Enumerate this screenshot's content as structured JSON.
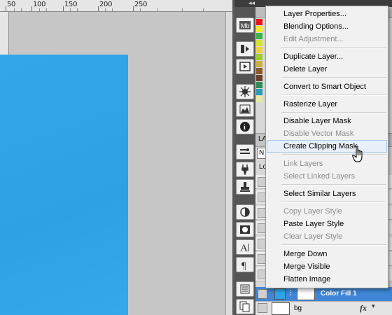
{
  "ruler": {
    "labels": [
      "50",
      "100",
      "150",
      "200",
      "250"
    ]
  },
  "layers_panel": {
    "tab_label": "LA",
    "blend_mode": "N",
    "lock_label": "Lo",
    "layers": [
      {
        "name": "Color Fill 1",
        "selected": true
      },
      {
        "name": "bg",
        "selected": false,
        "fx": "fx"
      }
    ]
  },
  "context_menu": {
    "items": [
      {
        "label": "Layer Properties...",
        "enabled": true
      },
      {
        "label": "Blending Options...",
        "enabled": true
      },
      {
        "label": "Edit Adjustment...",
        "enabled": false
      },
      {
        "label": "Duplicate Layer...",
        "enabled": true
      },
      {
        "label": "Delete Layer",
        "enabled": true
      },
      {
        "label": "Convert to Smart Object",
        "enabled": true
      },
      {
        "label": "Rasterize Layer",
        "enabled": true
      },
      {
        "label": "Disable Layer Mask",
        "enabled": true
      },
      {
        "label": "Disable Vector Mask",
        "enabled": false
      },
      {
        "label": "Create Clipping Mask",
        "enabled": true,
        "hovered": true
      },
      {
        "label": "Link Layers",
        "enabled": false
      },
      {
        "label": "Select Linked Layers",
        "enabled": false
      },
      {
        "label": "Select Similar Layers",
        "enabled": true
      },
      {
        "label": "Copy Layer Style",
        "enabled": false
      },
      {
        "label": "Paste Layer Style",
        "enabled": true
      },
      {
        "label": "Clear Layer Style",
        "enabled": false
      },
      {
        "label": "Merge Down",
        "enabled": true
      },
      {
        "label": "Merge Visible",
        "enabled": true
      },
      {
        "label": "Flatten Image",
        "enabled": true
      }
    ]
  },
  "dock_tools": [
    "mini-bridge-icon",
    "history-icon",
    "actions-icon",
    "navigator-icon",
    "histogram-icon",
    "info-icon",
    "tool-presets-icon",
    "brush-icon",
    "clone-source-icon",
    "color-balance-icon",
    "mask-icon",
    "character-icon",
    "paragraph-icon",
    "layer-comps-icon",
    "paths-icon"
  ],
  "colors": {
    "canvas_fill": "#2ea3e5",
    "selected_layer": "#3f87d6",
    "menu_hover": "#e8eff8"
  }
}
